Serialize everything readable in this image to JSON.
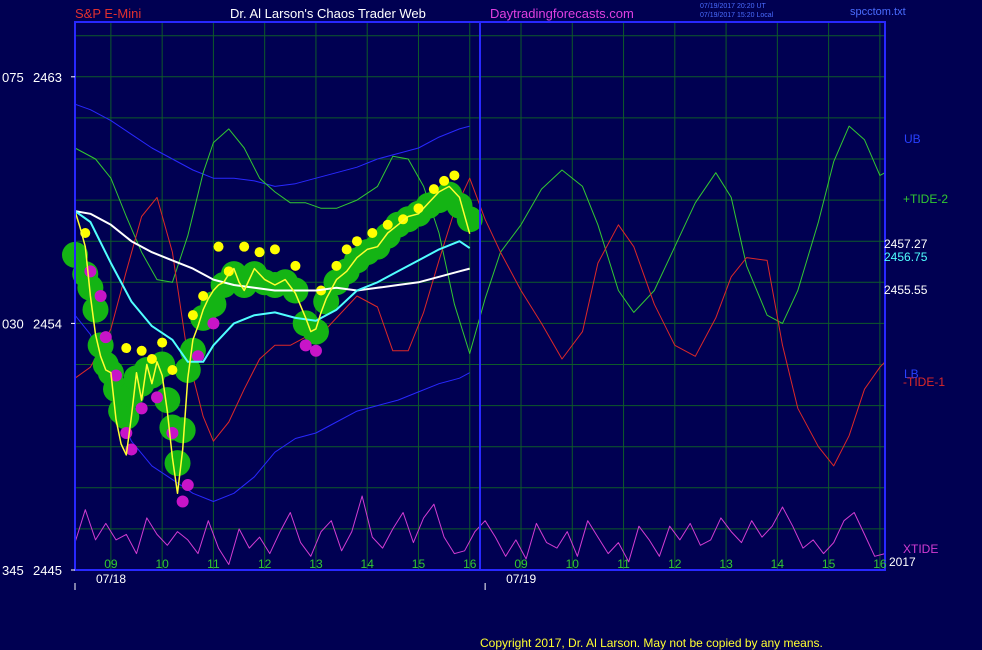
{
  "header": {
    "symbol": "S&P E-Mini",
    "title": "Dr. Al Larson's Chaos Trader Web",
    "site": "Daytradingforecasts.com",
    "stamp_ut": "07/19/2017 20:20 UT",
    "stamp_local": "07/19/2017 15:20 Local",
    "file": "spcctom.txt"
  },
  "footer": {
    "copyright": "Copyright 2017, Dr. Al Larson. May not be copied by any means."
  },
  "colors": {
    "background": "#000052",
    "frame": "#2828ff",
    "grid": "#0e5a2a",
    "price": "#ffff30",
    "fast_ma": "#50ffff",
    "slow_ma": "#ffffff",
    "tide2": "#32c832",
    "tide1": "#dc2828",
    "xtide": "#d23cd2",
    "bands": "#2828ff",
    "green_dots": "#14b414",
    "yellow_dots": "#ffff00",
    "magenta_dots": "#c814c8"
  },
  "chart_data": {
    "type": "line",
    "y_axis": {
      "range": [
        2445,
        2465
      ],
      "ticks": [
        {
          "value": 2463,
          "prefix": "075",
          "label": "2463"
        },
        {
          "value": 2454,
          "prefix": "030",
          "label": "2454"
        },
        {
          "value": 2445,
          "prefix": "345",
          "label": "2445"
        }
      ]
    },
    "x_axis": {
      "range": [
        8.3,
        24.1
      ],
      "hour_ticks": [
        {
          "x": 9,
          "label": "09"
        },
        {
          "x": 10,
          "label": "10"
        },
        {
          "x": 11,
          "label": "11"
        },
        {
          "x": 12,
          "label": "12"
        },
        {
          "x": 13,
          "label": "13"
        },
        {
          "x": 14,
          "label": "14"
        },
        {
          "x": 15,
          "label": "15"
        },
        {
          "x": 16,
          "label": "16"
        },
        {
          "x": 17,
          "label": "09"
        },
        {
          "x": 18,
          "label": "10"
        },
        {
          "x": 19,
          "label": "11"
        },
        {
          "x": 20,
          "label": "12"
        },
        {
          "x": 21,
          "label": "13"
        },
        {
          "x": 22,
          "label": "14"
        },
        {
          "x": 23,
          "label": "15"
        },
        {
          "x": 24,
          "label": "16"
        }
      ],
      "date_labels": [
        {
          "x": 8.3,
          "label": "07/18"
        },
        {
          "x": 16.3,
          "label": "07/19"
        }
      ],
      "year_label": "2017",
      "session_break": 16
    },
    "grid": true,
    "right_labels": {
      "ub": "UB",
      "tide2": "+TIDE-2",
      "price_last": "2457.27",
      "fast_ma_last": "2456.75",
      "slow_ma_last": "2455.55",
      "lb": "LB",
      "tide1": "-TIDE-1",
      "xtide": "XTIDE"
    },
    "series": [
      {
        "key": "price",
        "x": [
          8.3,
          8.4,
          8.5,
          8.6,
          8.7,
          8.8,
          8.9,
          9.0,
          9.1,
          9.2,
          9.3,
          9.4,
          9.5,
          9.6,
          9.7,
          9.8,
          9.9,
          10.0,
          10.1,
          10.2,
          10.3,
          10.4,
          10.5,
          10.6,
          10.7,
          10.8,
          10.9,
          11.0,
          11.1,
          11.2,
          11.3,
          11.4,
          11.5,
          11.6,
          11.8,
          12.0,
          12.2,
          12.4,
          12.6,
          12.8,
          12.9,
          13.0,
          13.1,
          13.2,
          13.4,
          13.6,
          13.8,
          14.0,
          14.2,
          14.4,
          14.6,
          14.8,
          15.0,
          15.2,
          15.4,
          15.6,
          15.8,
          16.0
        ],
        "y": [
          2458.1,
          2457.5,
          2456.8,
          2455.0,
          2453.6,
          2452.8,
          2452.3,
          2452.2,
          2450.5,
          2449.6,
          2449.2,
          2450.6,
          2452.2,
          2451.2,
          2452.5,
          2451.8,
          2452.6,
          2452.1,
          2450.8,
          2449.1,
          2447.8,
          2449.4,
          2452.0,
          2453.4,
          2453.9,
          2454.5,
          2454.9,
          2455.2,
          2455.4,
          2455.5,
          2455.8,
          2456.0,
          2455.5,
          2455.2,
          2456.0,
          2455.6,
          2455.4,
          2455.6,
          2455.1,
          2454.2,
          2453.7,
          2453.8,
          2454.4,
          2454.9,
          2455.6,
          2455.9,
          2456.4,
          2456.7,
          2456.8,
          2457.3,
          2457.6,
          2457.9,
          2458.0,
          2458.4,
          2458.8,
          2459.0,
          2458.6,
          2457.27
        ]
      },
      {
        "key": "fast_ma",
        "x": [
          8.3,
          8.6,
          9.0,
          9.4,
          9.8,
          10.2,
          10.5,
          10.8,
          11.0,
          11.4,
          11.8,
          12.2,
          12.6,
          13.0,
          13.4,
          13.8,
          14.2,
          14.6,
          15.0,
          15.4,
          15.8,
          16.0
        ],
        "y": [
          2458.1,
          2457.7,
          2456.2,
          2454.8,
          2453.9,
          2453.4,
          2452.6,
          2452.6,
          2453.2,
          2454.0,
          2454.3,
          2454.4,
          2454.2,
          2454.1,
          2454.5,
          2455.2,
          2455.5,
          2455.9,
          2456.3,
          2456.7,
          2457.0,
          2456.75
        ]
      },
      {
        "key": "slow_ma",
        "x": [
          8.3,
          8.6,
          9.0,
          9.4,
          9.8,
          10.2,
          10.6,
          11.0,
          11.4,
          11.8,
          12.2,
          12.6,
          13.0,
          13.4,
          13.8,
          14.2,
          14.6,
          15.0,
          15.4,
          15.8,
          16.0
        ],
        "y": [
          2458.1,
          2458.0,
          2457.6,
          2457.0,
          2456.6,
          2456.3,
          2456.0,
          2455.6,
          2455.4,
          2455.3,
          2455.2,
          2455.2,
          2455.2,
          2455.3,
          2455.2,
          2455.3,
          2455.4,
          2455.5,
          2455.7,
          2455.9,
          2456.0
        ]
      },
      {
        "key": "upper_band",
        "x": [
          8.3,
          8.6,
          9.0,
          9.4,
          9.8,
          10.2,
          10.6,
          11.0,
          11.4,
          11.8,
          12.2,
          12.6,
          13.0,
          13.4,
          13.8,
          14.2,
          14.6,
          15.0,
          15.4,
          15.8,
          16.0
        ],
        "y": [
          2462.0,
          2461.8,
          2461.4,
          2460.9,
          2460.4,
          2460.0,
          2459.6,
          2459.3,
          2459.3,
          2459.2,
          2459.0,
          2459.1,
          2459.3,
          2459.5,
          2459.7,
          2460.0,
          2460.2,
          2460.4,
          2460.8,
          2461.1,
          2461.2
        ]
      },
      {
        "key": "lower_band",
        "x": [
          8.3,
          8.6,
          9.0,
          9.4,
          9.8,
          10.2,
          10.6,
          11.0,
          11.4,
          11.8,
          12.2,
          12.6,
          13.0,
          13.4,
          13.8,
          14.2,
          14.6,
          15.0,
          15.4,
          15.8,
          16.0
        ],
        "y": [
          2454.3,
          2453.6,
          2451.4,
          2449.7,
          2448.8,
          2448.3,
          2447.8,
          2447.5,
          2447.8,
          2448.4,
          2449.3,
          2449.8,
          2450.0,
          2450.4,
          2450.8,
          2451.0,
          2451.2,
          2451.5,
          2451.8,
          2452.0,
          2452.2
        ]
      },
      {
        "key": "tide2",
        "x": [
          8.3,
          8.7,
          9.0,
          9.3,
          9.6,
          9.9,
          10.2,
          10.5,
          10.8,
          11.0,
          11.3,
          11.6,
          11.9,
          12.2,
          12.5,
          12.8,
          13.1,
          13.4,
          13.8,
          14.2,
          14.5,
          14.8,
          15.1,
          15.4,
          15.7,
          16.0,
          16.3,
          16.6,
          17.0,
          17.4,
          17.8,
          18.2,
          18.5,
          18.9,
          19.2,
          19.6,
          20.0,
          20.4,
          20.8,
          21.1,
          21.4,
          21.8,
          22.1,
          22.4,
          22.8,
          23.1,
          23.4,
          23.7,
          24.0,
          24.1
        ],
        "y": [
          2460.4,
          2460.0,
          2459.3,
          2457.9,
          2456.6,
          2455.6,
          2455.5,
          2457.2,
          2459.5,
          2460.6,
          2461.1,
          2460.4,
          2459.3,
          2458.8,
          2458.4,
          2458.4,
          2458.2,
          2458.2,
          2458.5,
          2459.0,
          2460.1,
          2460.0,
          2459.0,
          2457.3,
          2454.7,
          2452.9,
          2454.9,
          2456.6,
          2457.6,
          2458.9,
          2459.6,
          2459.0,
          2457.6,
          2455.2,
          2454.4,
          2455.2,
          2456.8,
          2458.4,
          2459.5,
          2458.6,
          2456.1,
          2454.3,
          2454.0,
          2455.2,
          2457.7,
          2459.9,
          2461.2,
          2460.7,
          2459.4,
          2459.5
        ]
      },
      {
        "key": "tide1",
        "x": [
          8.3,
          8.6,
          9.0,
          9.3,
          9.6,
          9.9,
          10.2,
          10.5,
          10.8,
          11.0,
          11.3,
          11.6,
          11.9,
          12.2,
          12.5,
          12.8,
          13.1,
          13.4,
          13.8,
          14.2,
          14.5,
          14.8,
          15.1,
          15.4,
          15.7,
          16.0,
          16.3,
          16.6,
          17.0,
          17.4,
          17.8,
          18.2,
          18.5,
          18.9,
          19.2,
          19.6,
          20.0,
          20.4,
          20.8,
          21.1,
          21.4,
          21.8,
          22.1,
          22.4,
          22.8,
          23.1,
          23.4,
          23.7,
          24.0,
          24.1
        ],
        "y": [
          2452.0,
          2452.4,
          2453.8,
          2455.9,
          2457.9,
          2458.6,
          2456.6,
          2452.8,
          2450.6,
          2449.7,
          2450.4,
          2451.6,
          2452.7,
          2453.2,
          2453.2,
          2453.5,
          2453.6,
          2454.2,
          2455.0,
          2454.6,
          2453.0,
          2453.0,
          2454.4,
          2456.3,
          2458.1,
          2459.3,
          2457.8,
          2456.6,
          2455.2,
          2454.0,
          2452.7,
          2453.7,
          2456.2,
          2457.6,
          2456.8,
          2454.7,
          2453.2,
          2452.8,
          2454.2,
          2455.7,
          2456.4,
          2456.3,
          2453.2,
          2450.9,
          2449.5,
          2448.8,
          2449.9,
          2451.6,
          2452.4,
          2452.6
        ]
      },
      {
        "key": "xtide",
        "x": [
          8.3,
          8.5,
          8.7,
          8.9,
          9.1,
          9.3,
          9.5,
          9.7,
          9.9,
          10.1,
          10.3,
          10.5,
          10.7,
          10.9,
          11.1,
          11.3,
          11.5,
          11.7,
          11.9,
          12.1,
          12.3,
          12.5,
          12.7,
          12.9,
          13.1,
          13.3,
          13.5,
          13.7,
          13.9,
          14.1,
          14.3,
          14.5,
          14.7,
          14.9,
          15.1,
          15.3,
          15.5,
          15.7,
          15.9,
          16.1,
          16.3,
          16.5,
          16.7,
          16.9,
          17.1,
          17.3,
          17.5,
          17.7,
          17.9,
          18.1,
          18.3,
          18.5,
          18.7,
          18.9,
          19.1,
          19.3,
          19.5,
          19.7,
          19.9,
          20.1,
          20.3,
          20.5,
          20.7,
          20.9,
          21.1,
          21.3,
          21.5,
          21.7,
          21.9,
          22.1,
          22.3,
          22.5,
          22.7,
          22.9,
          23.1,
          23.3,
          23.5,
          23.7,
          23.9,
          24.1
        ],
        "y": [
          2446.0,
          2447.2,
          2446.1,
          2446.7,
          2446.1,
          2446.3,
          2445.6,
          2446.9,
          2446.3,
          2445.9,
          2446.4,
          2446.1,
          2445.6,
          2446.8,
          2445.8,
          2445.2,
          2446.5,
          2445.8,
          2446.2,
          2445.6,
          2446.4,
          2447.1,
          2446.0,
          2445.5,
          2446.4,
          2446.8,
          2445.7,
          2446.4,
          2447.7,
          2446.2,
          2445.8,
          2446.5,
          2447.1,
          2446.0,
          2446.9,
          2447.4,
          2446.2,
          2445.6,
          2445.7,
          2446.4,
          2446.8,
          2446.2,
          2445.5,
          2446.1,
          2445.4,
          2446.7,
          2446.0,
          2445.8,
          2446.4,
          2445.5,
          2446.8,
          2446.2,
          2445.6,
          2446.0,
          2445.3,
          2446.6,
          2446.1,
          2445.5,
          2446.6,
          2446.1,
          2446.7,
          2445.9,
          2446.1,
          2446.9,
          2446.4,
          2446.0,
          2446.8,
          2446.2,
          2446.6,
          2447.3,
          2446.6,
          2445.8,
          2446.1,
          2445.6,
          2446.0,
          2446.8,
          2447.1,
          2446.3,
          2445.5,
          2445.6
        ]
      }
    ],
    "markers": {
      "green": [
        [
          8.3,
          2456.5
        ],
        [
          8.5,
          2455.8
        ],
        [
          8.6,
          2455.3
        ],
        [
          8.7,
          2454.5
        ],
        [
          8.8,
          2453.2
        ],
        [
          8.9,
          2452.5
        ],
        [
          9.0,
          2452.2
        ],
        [
          9.1,
          2451.6
        ],
        [
          9.2,
          2450.8
        ],
        [
          9.3,
          2450.6
        ],
        [
          9.4,
          2451.4
        ],
        [
          9.5,
          2452.0
        ],
        [
          9.6,
          2451.8
        ],
        [
          9.7,
          2452.3
        ],
        [
          9.8,
          2452.1
        ],
        [
          9.9,
          2452.4
        ],
        [
          10.0,
          2452.5
        ],
        [
          10.1,
          2451.2
        ],
        [
          10.2,
          2450.2
        ],
        [
          10.3,
          2448.9
        ],
        [
          10.4,
          2450.1
        ],
        [
          10.5,
          2452.3
        ],
        [
          10.6,
          2453.0
        ],
        [
          10.8,
          2454.2
        ],
        [
          11.0,
          2454.7
        ],
        [
          11.2,
          2455.4
        ],
        [
          11.4,
          2455.8
        ],
        [
          11.6,
          2455.4
        ],
        [
          11.8,
          2455.8
        ],
        [
          12.0,
          2455.5
        ],
        [
          12.2,
          2455.4
        ],
        [
          12.4,
          2455.5
        ],
        [
          12.6,
          2455.2
        ],
        [
          12.8,
          2454.0
        ],
        [
          13.0,
          2453.7
        ],
        [
          13.2,
          2454.8
        ],
        [
          13.4,
          2455.5
        ],
        [
          13.6,
          2455.9
        ],
        [
          13.8,
          2456.3
        ],
        [
          14.0,
          2456.6
        ],
        [
          14.2,
          2456.8
        ],
        [
          14.4,
          2457.2
        ],
        [
          14.6,
          2457.6
        ],
        [
          14.8,
          2457.8
        ],
        [
          15.0,
          2458.0
        ],
        [
          15.2,
          2458.3
        ],
        [
          15.4,
          2458.5
        ],
        [
          15.6,
          2458.7
        ],
        [
          15.8,
          2458.3
        ],
        [
          16.0,
          2457.8
        ]
      ],
      "yellow": [
        [
          8.5,
          2457.3
        ],
        [
          9.3,
          2453.1
        ],
        [
          9.6,
          2453.0
        ],
        [
          9.8,
          2452.7
        ],
        [
          10.0,
          2453.3
        ],
        [
          10.2,
          2452.3
        ],
        [
          10.6,
          2454.3
        ],
        [
          10.8,
          2455.0
        ],
        [
          11.1,
          2456.8
        ],
        [
          11.3,
          2455.9
        ],
        [
          11.6,
          2456.8
        ],
        [
          11.9,
          2456.6
        ],
        [
          12.2,
          2456.7
        ],
        [
          12.6,
          2456.1
        ],
        [
          13.1,
          2455.2
        ],
        [
          13.4,
          2456.1
        ],
        [
          13.6,
          2456.7
        ],
        [
          13.8,
          2457.0
        ],
        [
          14.1,
          2457.3
        ],
        [
          14.4,
          2457.6
        ],
        [
          14.7,
          2457.8
        ],
        [
          15.0,
          2458.2
        ],
        [
          15.3,
          2458.9
        ],
        [
          15.5,
          2459.2
        ],
        [
          15.7,
          2459.4
        ]
      ],
      "magenta": [
        [
          8.6,
          2455.9
        ],
        [
          8.8,
          2455.0
        ],
        [
          8.9,
          2453.5
        ],
        [
          9.1,
          2452.1
        ],
        [
          9.3,
          2450.0
        ],
        [
          9.4,
          2449.4
        ],
        [
          9.6,
          2450.9
        ],
        [
          9.9,
          2451.3
        ],
        [
          10.2,
          2450.0
        ],
        [
          10.4,
          2447.5
        ],
        [
          10.5,
          2448.1
        ],
        [
          10.7,
          2452.8
        ],
        [
          11.0,
          2454.0
        ],
        [
          12.8,
          2453.2
        ],
        [
          13.0,
          2453.0
        ]
      ]
    }
  }
}
